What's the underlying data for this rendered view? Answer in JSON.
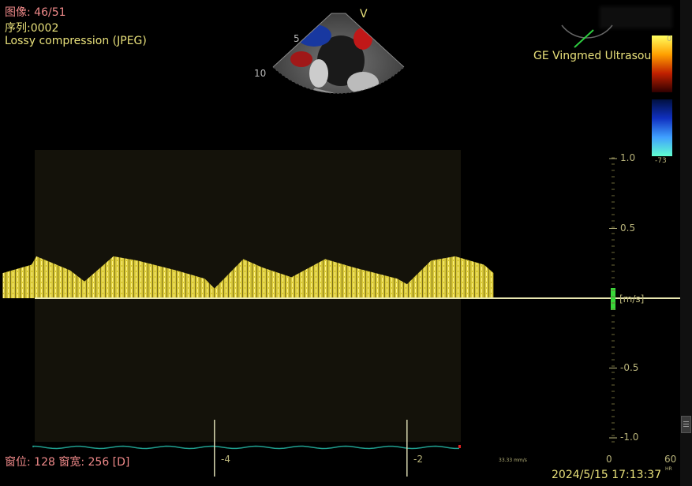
{
  "overlay": {
    "image_label": "图像: 46/51",
    "series_label": "序列:0002",
    "compression": "Lossy compression (JPEG)",
    "vendor": "GE Vingmed Ultrasound",
    "window": "窗位: 128 窗宽: 256 [D]",
    "datetime": "2024/5/15 17:13:37",
    "sweep_speed": "33.33 mm/s",
    "hr_value": "60",
    "hr_unit": "HR"
  },
  "sector": {
    "mode_marker": "V",
    "depth_labels": [
      "5",
      "10"
    ]
  },
  "color_bar": {
    "top_label": "0",
    "bottom_label": "-73",
    "top_colors": [
      "#ffff60",
      "#ffa000",
      "#c02000",
      "#300000"
    ],
    "bottom_colors": [
      "#001040",
      "#1030c0",
      "#40a0ff",
      "#60ffd0"
    ]
  },
  "spectrum": {
    "unit": "[m/s]",
    "y_ticks": [
      {
        "v": 1.0,
        "label": "1.0"
      },
      {
        "v": 0.5,
        "label": "0.5"
      },
      {
        "v": -0.5,
        "label": "-0.5"
      },
      {
        "v": -1.0,
        "label": "-1.0"
      }
    ],
    "x_ticks": [
      {
        "t": -4,
        "label": "-4"
      },
      {
        "t": -2,
        "label": "-2"
      },
      {
        "t": 0,
        "label": "0"
      }
    ],
    "envelope": [
      [
        -6.3,
        0.18
      ],
      [
        -6.0,
        0.24
      ],
      [
        -5.95,
        0.3
      ],
      [
        -5.6,
        0.2
      ],
      [
        -5.45,
        0.12
      ],
      [
        -5.15,
        0.3
      ],
      [
        -4.9,
        0.27
      ],
      [
        -4.5,
        0.2
      ],
      [
        -4.2,
        0.14
      ],
      [
        -4.1,
        0.07
      ],
      [
        -3.8,
        0.28
      ],
      [
        -3.6,
        0.22
      ],
      [
        -3.3,
        0.15
      ],
      [
        -2.95,
        0.28
      ],
      [
        -2.65,
        0.22
      ],
      [
        -2.2,
        0.14
      ],
      [
        -2.1,
        0.1
      ],
      [
        -1.85,
        0.27
      ],
      [
        -1.6,
        0.3
      ],
      [
        -1.3,
        0.24
      ],
      [
        -1.2,
        0.18
      ]
    ],
    "colors": {
      "spectrum": "#e6d540",
      "baseline": "#e8e6b0",
      "ecg": "#20a090",
      "velocity_marker": "#39d839"
    }
  },
  "ecg_markers": [
    -4.1,
    -2.1
  ]
}
